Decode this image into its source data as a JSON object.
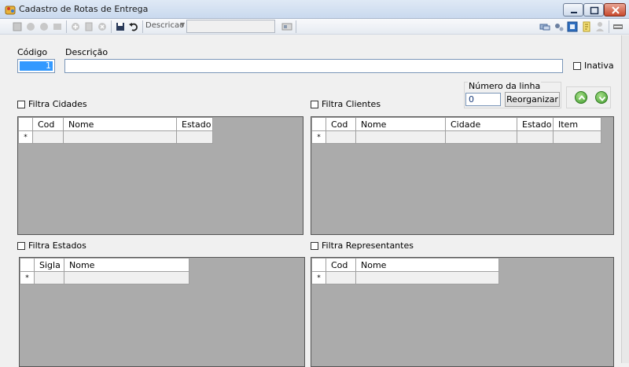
{
  "window": {
    "title": "Cadastro de Rotas de Entrega"
  },
  "toolbar": {
    "search_field_label": "Descricao",
    "search_value": ""
  },
  "form": {
    "codigo_label": "Código",
    "codigo_value": "1",
    "descricao_label": "Descrição",
    "descricao_value": "",
    "inativa_label": "Inativa",
    "numero_linha_label": "Número da linha",
    "numero_linha_value": "0",
    "reorganizar_label": "Reorganizar"
  },
  "filters": {
    "cidades": "Filtra Cidades",
    "clientes": "Filtra Clientes",
    "estados": "Filtra Estados",
    "representantes": "Filtra Representantes"
  },
  "grids": {
    "new_row_marker": "*",
    "cidades": {
      "columns": [
        "Cod",
        "Nome",
        "Estado"
      ]
    },
    "clientes": {
      "columns": [
        "Cod",
        "Nome",
        "Cidade",
        "Estado",
        "Item"
      ]
    },
    "estados": {
      "columns": [
        "Sigla",
        "Nome"
      ]
    },
    "representantes": {
      "columns": [
        "Cod",
        "Nome"
      ]
    }
  },
  "icons": {
    "app": "app-icon",
    "minimize": "minimize-icon",
    "maximize": "maximize-icon",
    "close": "close-icon",
    "toolbar": [
      "new-icon",
      "first-icon",
      "prev-icon",
      "next-icon",
      "add-icon",
      "edit-icon",
      "delete-icon",
      "save-icon",
      "undo-icon",
      "view-icon",
      "link-icon",
      "config-icon",
      "refresh-icon",
      "report-icon",
      "user-icon",
      "exit-icon"
    ]
  }
}
